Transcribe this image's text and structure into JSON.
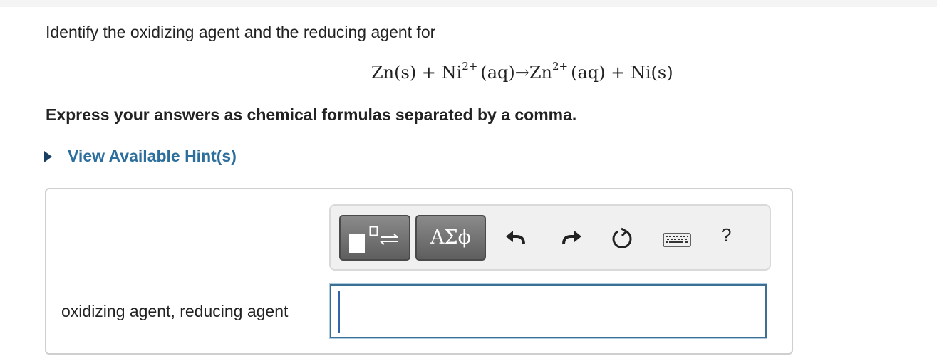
{
  "question": {
    "prompt": "Identify the oxidizing agent and the reducing agent for"
  },
  "equation": {
    "part1": "Zn(s) + Ni",
    "charge1": "2+",
    "part2": "(aq)→Zn",
    "charge2": "2+",
    "part3": "(aq) + Ni(s)"
  },
  "instruction": "Express your answers as chemical formulas separated by a comma.",
  "hint": {
    "label": "View Available Hint(s)"
  },
  "toolbar": {
    "symbols_label": "ΑΣϕ",
    "help_label": "?",
    "icons": [
      "templates-icon",
      "undo-icon",
      "redo-icon",
      "reset-icon",
      "keyboard-icon",
      "help-icon"
    ]
  },
  "answer": {
    "label": "oxidizing agent, reducing agent",
    "value": ""
  },
  "colors": {
    "hint_link": "#2d6f9c",
    "hint_triangle": "#1b3f63",
    "input_border": "#3c6f94",
    "toolbar_button": "#6e6e6e"
  }
}
